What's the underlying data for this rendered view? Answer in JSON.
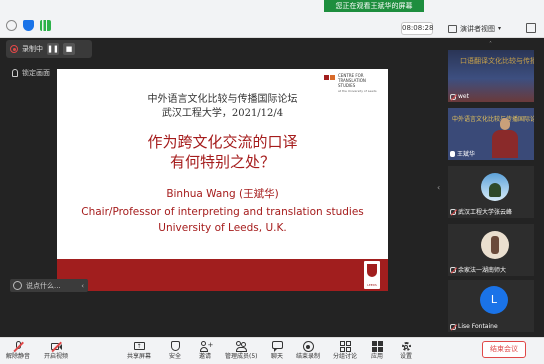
{
  "banner": {
    "sharing_text": "您正在观看王斌华的屏幕"
  },
  "header": {
    "clock": "08:08:28",
    "view_mode_label": "演讲者视图"
  },
  "recording": {
    "label": "录制中"
  },
  "lock_screen_label": "锁定画面",
  "slide": {
    "logo_text": "CENTRE FOR TRANSLATION STUDIES",
    "logo_sub": "at the University of Leeds",
    "forum": "中外语言文化比较与传播国际论坛",
    "university_date": "武汉工程大学，2021/12/4",
    "title_line1": "作为跨文化交流的口译",
    "title_line2": "有何特别之处？",
    "speaker_name": "Binhua Wang (王斌华)",
    "speaker_role": "Chair/Professor of interpreting and translation studies",
    "speaker_org": "University of Leeds, U.K.",
    "crest_text": "LEEDS"
  },
  "chat": {
    "placeholder": "说点什么..."
  },
  "participants": [
    {
      "name": "wet",
      "bg_text": "口语翻译文化比较与传播"
    },
    {
      "name": "王斌华",
      "bg_text": "中外语言文化比较与传播国际论坛"
    },
    {
      "name": "武汉工程大学张云峰"
    },
    {
      "name": "余家法一湖南师大"
    },
    {
      "name": "Lise Fontaine",
      "initial": "L"
    }
  ],
  "toolbar": {
    "mute": "解除静音",
    "video": "开启视频",
    "share": "共享屏幕",
    "security": "安全",
    "invite": "邀请",
    "manage": "管理成员(5)",
    "chat": "聊天",
    "end_record": "结束录制",
    "breakout": "分组讨论",
    "apps": "应用",
    "settings": "设置",
    "end_meeting": "结束会议"
  },
  "colors": {
    "accent_red": "#a51c1c",
    "brand_blue": "#1a73e8",
    "end_red": "#e04848"
  }
}
